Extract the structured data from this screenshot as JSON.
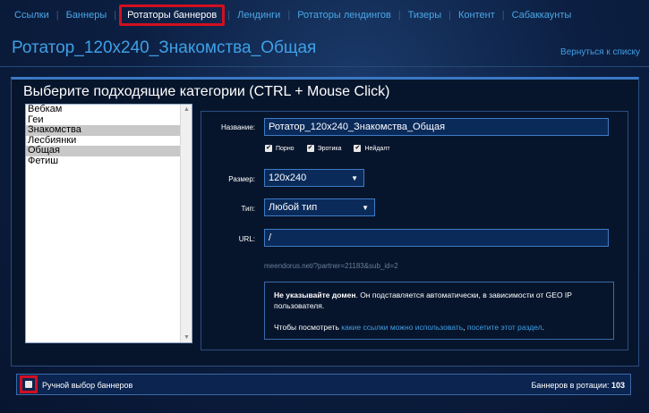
{
  "nav": {
    "items": [
      "Ссылки",
      "Баннеры",
      "Ротаторы баннеров",
      "Лендинги",
      "Ротаторы лендингов",
      "Тизеры",
      "Контент",
      "Сабаккаунты"
    ],
    "active_index": 2
  },
  "page": {
    "title": "Ротатор_120x240_Знакомства_Общая",
    "back_link": "Вернуться к списку"
  },
  "card": {
    "title": "Выберите подходящие категории (CTRL + Mouse Click)"
  },
  "categories": {
    "options": [
      "Вебкам",
      "Геи",
      "Знакомства",
      "Лесбиянки",
      "Общая",
      "Фетиш"
    ],
    "selected": [
      "Знакомства",
      "Общая"
    ]
  },
  "form": {
    "name_label": "Название:",
    "name_value": "Ротатор_120x240_Знакомства_Общая",
    "checkboxes": [
      {
        "label": "Порно",
        "checked": true
      },
      {
        "label": "Эротика",
        "checked": true
      },
      {
        "label": "Нейдалт",
        "checked": true
      }
    ],
    "size_label": "Размер:",
    "size_value": "120x240",
    "type_label": "Тип:",
    "type_value": "Любой тип",
    "url_label": "URL:",
    "url_value": "/",
    "url_hint_domain": "meendorus.net",
    "url_hint_rest": "/?partner=21183&sub_id=2"
  },
  "info": {
    "bold": "Не указывайте домен",
    "text1": ". Он подставляется автоматически, в зависимости от GEO IP пользователя.",
    "text2": "Чтобы посмотреть ",
    "link1": "какие ссылки можно использовать",
    "text3": ", ",
    "link2": "посетите этот раздел",
    "text4": "."
  },
  "bottom": {
    "manual_label": "Ручной выбор баннеров",
    "manual_checked": false,
    "rotation_label": "Баннеров в ротации: ",
    "rotation_count": "103"
  },
  "colors": {
    "accent": "#3fa0e6",
    "highlight_border": "#d01020"
  },
  "icons": {
    "scroll_up": "scroll-up-arrow",
    "scroll_down": "scroll-down-arrow",
    "select_caret": "caret-down"
  }
}
